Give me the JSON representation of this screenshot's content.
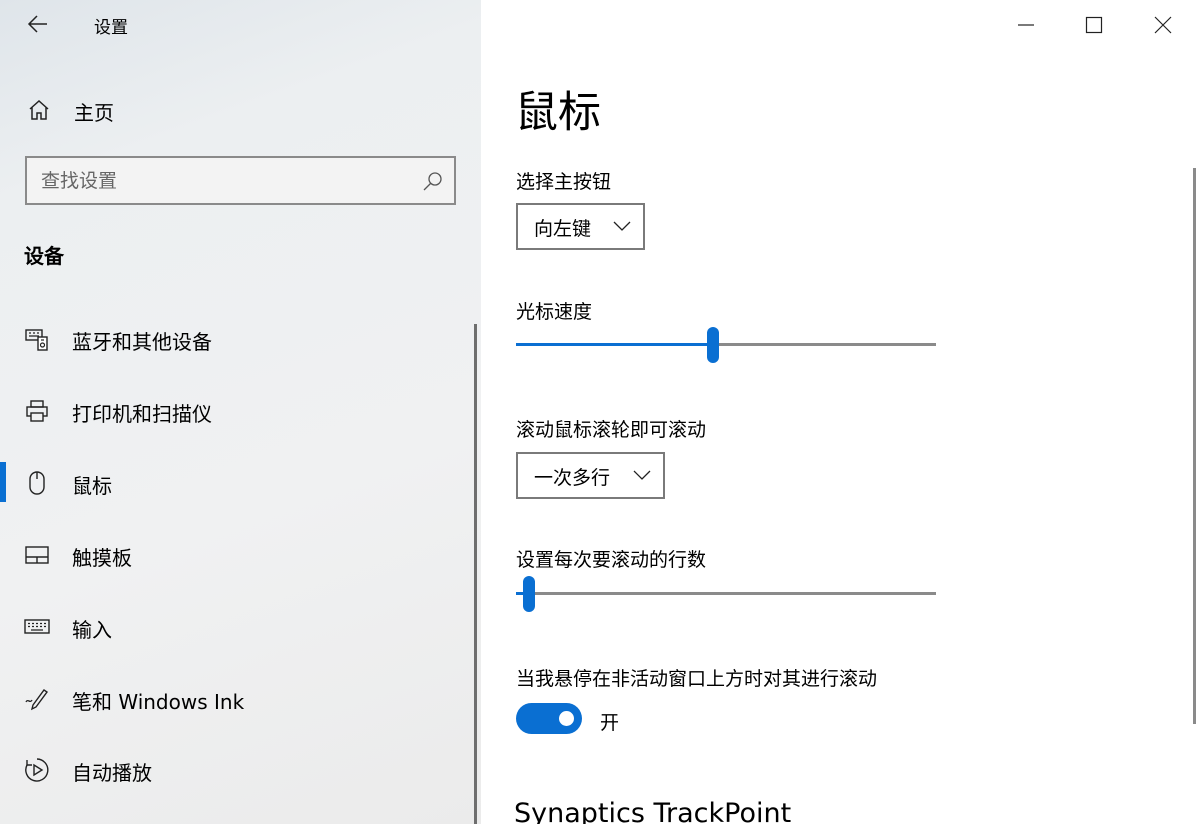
{
  "window": {
    "app_title": "设置",
    "icons": {
      "back": "back-arrow-icon",
      "minimize": "minimize-icon",
      "maximize": "maximize-icon",
      "close": "close-icon"
    }
  },
  "nav": {
    "home_label": "主页",
    "search_placeholder": "查找设置",
    "section_title": "设备",
    "items": [
      {
        "label": "蓝牙和其他设备",
        "icon": "bluetooth-devices-icon"
      },
      {
        "label": "打印机和扫描仪",
        "icon": "printer-icon"
      },
      {
        "label": "鼠标",
        "icon": "mouse-icon",
        "selected": true
      },
      {
        "label": "触摸板",
        "icon": "touchpad-icon"
      },
      {
        "label": "输入",
        "icon": "keyboard-icon"
      },
      {
        "label": "笔和 Windows Ink",
        "icon": "pen-icon"
      },
      {
        "label": "自动播放",
        "icon": "autoplay-icon"
      }
    ]
  },
  "main": {
    "title": "鼠标",
    "primary_button": {
      "label": "选择主按钮",
      "value": "向左键"
    },
    "cursor_speed": {
      "label": "光标速度",
      "value": 0.47
    },
    "scroll_mode": {
      "label": "滚动鼠标滚轮即可滚动",
      "value": "一次多行"
    },
    "scroll_lines": {
      "label": "设置每次要滚动的行数",
      "value": 0.03
    },
    "inactive_scroll": {
      "label": "当我悬停在非活动窗口上方时对其进行滚动",
      "state": "开",
      "on": true
    },
    "section2_title": "Synaptics TrackPoint"
  },
  "colors": {
    "accent": "#0a6fd2",
    "nav_bg": "#eceff1"
  }
}
